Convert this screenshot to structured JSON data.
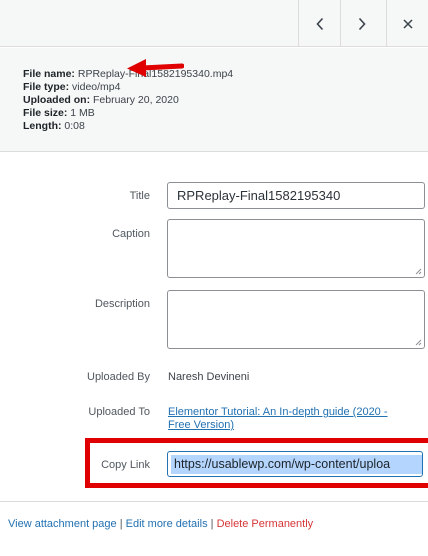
{
  "header": {
    "prev_icon": "chevron-left-icon",
    "next_icon": "chevron-right-icon",
    "close_icon": "close-icon"
  },
  "details": {
    "file_name_label": "File name:",
    "file_name_value": "RPReplay-Final1582195340.mp4",
    "file_type_label": "File type:",
    "file_type_value": "video/mp4",
    "uploaded_on_label": "Uploaded on:",
    "uploaded_on_value": "February 20, 2020",
    "file_size_label": "File size:",
    "file_size_value": "1 MB",
    "length_label": "Length:",
    "length_value": "0:08",
    "arrow_color": "#e00000"
  },
  "form": {
    "title_label": "Title",
    "title_value": "RPReplay-Final1582195340",
    "caption_label": "Caption",
    "caption_value": "",
    "description_label": "Description",
    "description_value": "",
    "uploaded_by_label": "Uploaded By",
    "uploaded_by_value": "Naresh Devineni",
    "uploaded_to_label": "Uploaded To",
    "uploaded_to_line1": "Elementor Tutorial: An In-depth guide (2020 -",
    "uploaded_to_line2": "Free Version)",
    "copy_link_label": "Copy Link",
    "copy_link_value": "https://usablewp.com/wp-content/uploa",
    "highlight_color": "#e00000"
  },
  "actions": {
    "view_attachment": "View attachment page",
    "separator1": " | ",
    "edit_details": "Edit more details",
    "separator2": " | ",
    "delete": "Delete Permanently"
  }
}
